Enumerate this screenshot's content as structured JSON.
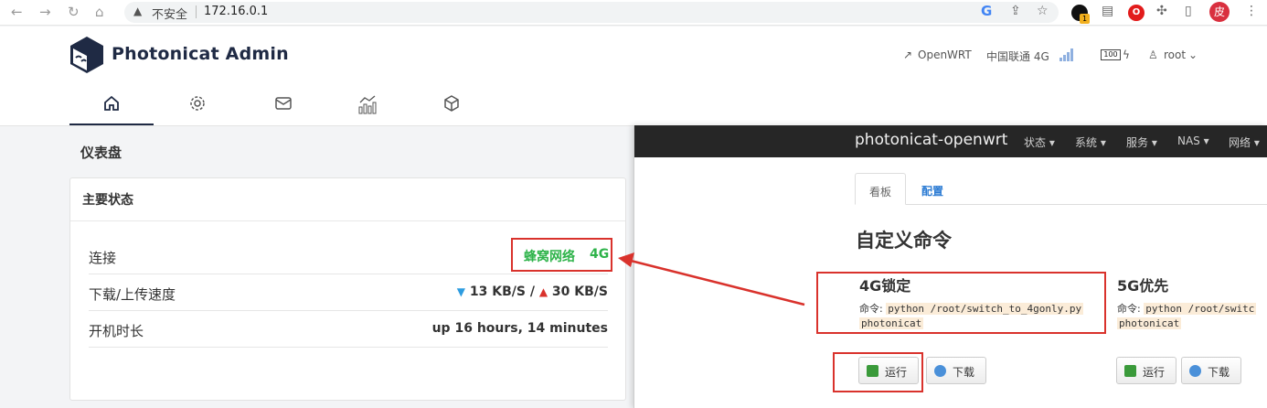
{
  "browser": {
    "insecure_label": "不安全",
    "url": "172.16.0.1",
    "avatar_char": "皮",
    "ext_badge": "1"
  },
  "header": {
    "brand": "Photonicat Admin",
    "openwrt_link": "OpenWRT",
    "carrier": "中国联通 4G",
    "battery": "100",
    "user": "root",
    "tabs": [
      "home-icon",
      "gear-icon",
      "mail-icon",
      "chart-icon",
      "cube-icon"
    ],
    "active_tab": 0
  },
  "dashboard": {
    "title": "仪表盘",
    "card_title": "主要状态",
    "rows": [
      {
        "label": "连接",
        "value_text": "蜂窝网络",
        "value_tag": "4G"
      },
      {
        "label": "下载/上传速度",
        "down": "13 KB/S",
        "sep": "/",
        "up": "30 KB/S"
      },
      {
        "label": "开机时长",
        "value": "up 16 hours, 14 minutes"
      }
    ]
  },
  "openwrt": {
    "brand": "photonicat-openwrt",
    "menu": [
      "状态",
      "系统",
      "服务",
      "NAS",
      "网络"
    ],
    "tabs": [
      "看板",
      "配置"
    ],
    "heading": "自定义命令",
    "commands": [
      {
        "title": "4G锁定",
        "cmd_label": "命令:",
        "cmd": "python /root/switch_to_4gonly.py",
        "arg": "photonicat"
      },
      {
        "title": "5G优先",
        "cmd_label": "命令:",
        "cmd": "python /root/switc",
        "arg": "photonicat"
      }
    ],
    "run_label": "运行",
    "download_label": "下载"
  },
  "colors": {
    "accent_green": "#2eb34a",
    "highlight_red": "#d9322c",
    "down_blue": "#2d9ce0"
  }
}
